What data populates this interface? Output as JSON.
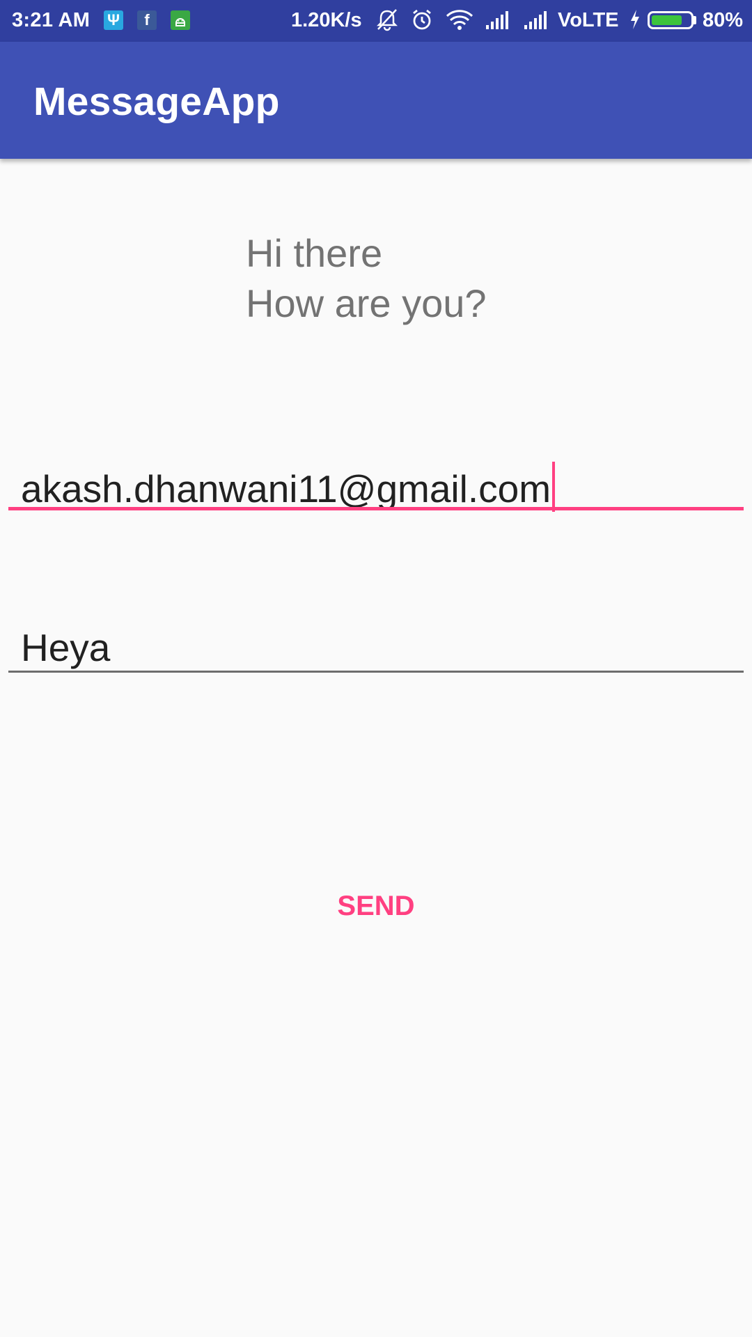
{
  "status_bar": {
    "time": "3:21 AM",
    "network_speed": "1.20K/s",
    "network_type": "VoLTE",
    "battery_percent_label": "80%",
    "battery_level": 0.8,
    "notification_icons": [
      "usb-icon",
      "facebook-icon",
      "android-icon"
    ],
    "system_icons": [
      "mute-icon",
      "alarm-icon",
      "wifi-icon",
      "signal-icon",
      "signal-icon",
      "charging-icon",
      "battery-icon"
    ]
  },
  "app_bar": {
    "title": "MessageApp"
  },
  "message": {
    "line1": "Hi there",
    "line2": "How are you?"
  },
  "email_field": {
    "value": "akash.dhanwani11@gmail.com"
  },
  "message_field": {
    "value": "Heya"
  },
  "send_button": {
    "label": "SEND"
  },
  "colors": {
    "status_bar": "#303f9f",
    "app_bar": "#3f51b5",
    "accent": "#ff4081",
    "background": "#fafafa"
  }
}
